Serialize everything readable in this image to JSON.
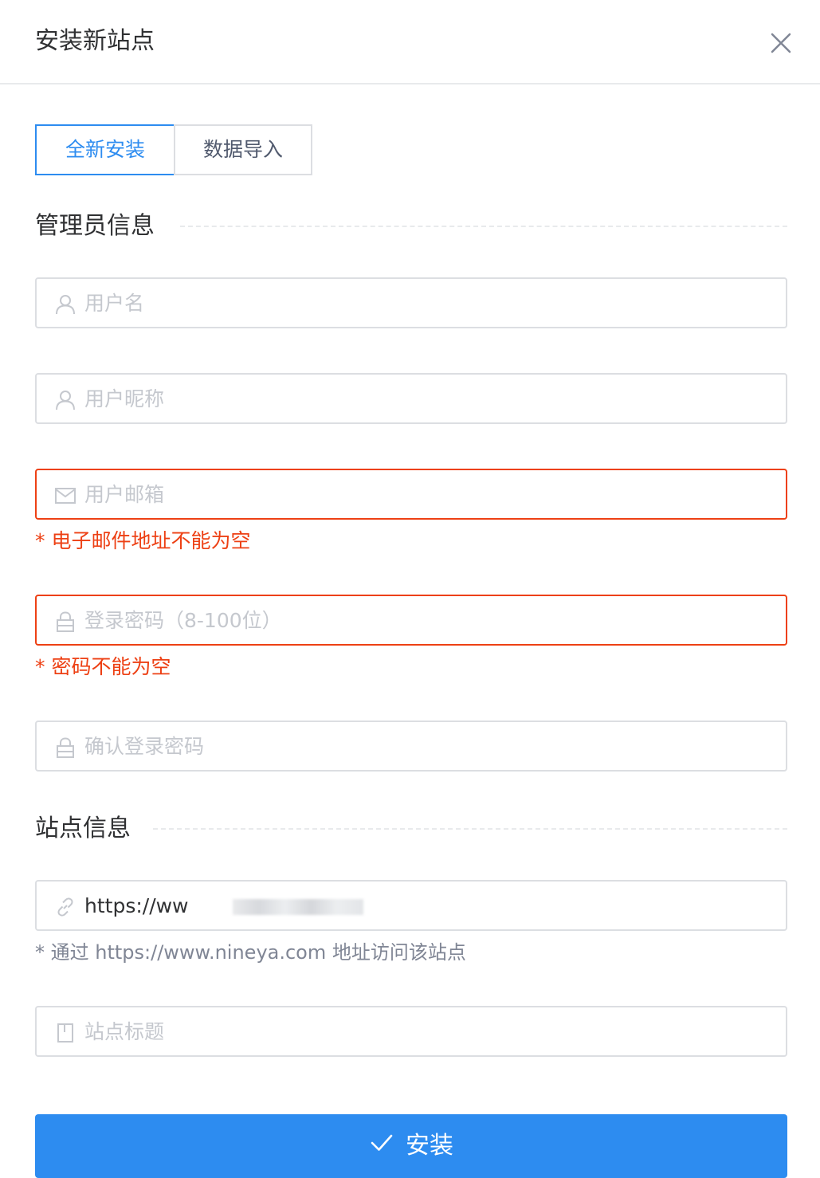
{
  "dialog": {
    "title": "安装新站点",
    "close_icon": "close-icon"
  },
  "tabs": [
    {
      "label": "全新安装",
      "active": true
    },
    {
      "label": "数据导入",
      "active": false
    }
  ],
  "admin_section": {
    "title": "管理员信息",
    "fields": {
      "username": {
        "placeholder": "用户名",
        "value": "",
        "icon": "user-icon"
      },
      "nickname": {
        "placeholder": "用户昵称",
        "value": "",
        "icon": "user-icon"
      },
      "email": {
        "placeholder": "用户邮箱",
        "value": "",
        "icon": "mail-icon",
        "error": "* 电子邮件地址不能为空"
      },
      "password": {
        "placeholder": "登录密码（8-100位）",
        "value": "",
        "icon": "lock-icon",
        "error": "* 密码不能为空"
      },
      "confirm_password": {
        "placeholder": "确认登录密码",
        "value": "",
        "icon": "lock-icon"
      }
    }
  },
  "site_section": {
    "title": "站点信息",
    "fields": {
      "url": {
        "value": "https://ww",
        "icon": "link-icon",
        "hint": "* 通过 https://www.nineya.com 地址访问该站点"
      },
      "site_title": {
        "placeholder": "站点标题",
        "value": "",
        "icon": "document-icon"
      }
    }
  },
  "submit": {
    "label": "安装",
    "icon": "checkmark-icon"
  },
  "colors": {
    "primary": "#2d8cf0",
    "error": "#ed4014",
    "border": "#dcdee2",
    "placeholder": "#c5c8ce",
    "hint": "#808695"
  }
}
